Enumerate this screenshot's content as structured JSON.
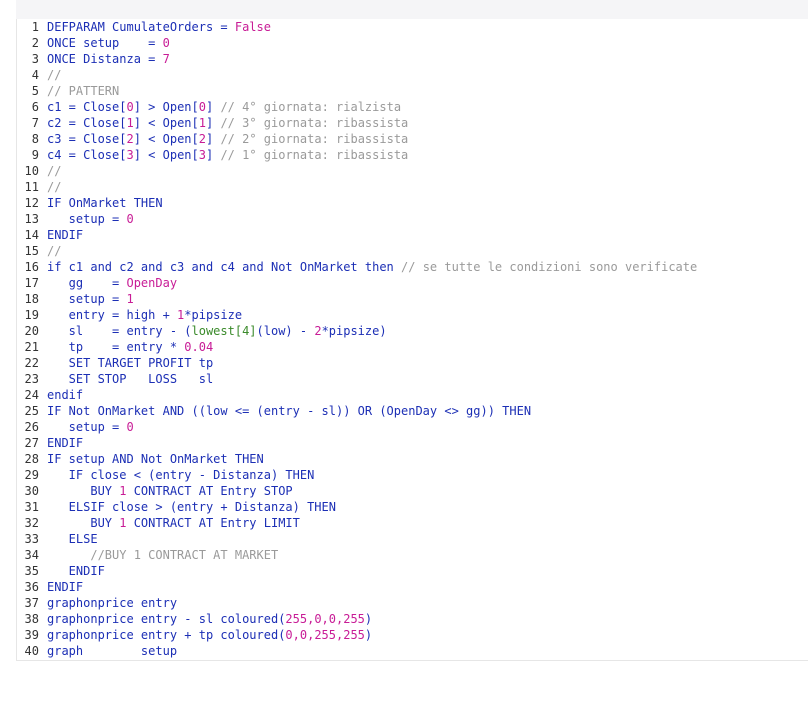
{
  "editor": {
    "lines": [
      [
        {
          "t": "DEFPARAM CumulateOrders = ",
          "c": "kw"
        },
        {
          "t": "False",
          "c": "n"
        }
      ],
      [
        {
          "t": "ONCE setup    = ",
          "c": "kw"
        },
        {
          "t": "0",
          "c": "n"
        }
      ],
      [
        {
          "t": "ONCE Distanza = ",
          "c": "kw"
        },
        {
          "t": "7",
          "c": "n"
        }
      ],
      [
        {
          "t": "//",
          "c": "c"
        }
      ],
      [
        {
          "t": "// PATTERN",
          "c": "c"
        }
      ],
      [
        {
          "t": "c1 = Close[",
          "c": "kw"
        },
        {
          "t": "0",
          "c": "n"
        },
        {
          "t": "] > Open[",
          "c": "kw"
        },
        {
          "t": "0",
          "c": "n"
        },
        {
          "t": "] ",
          "c": "kw"
        },
        {
          "t": "// 4° giornata: rialzista",
          "c": "c"
        }
      ],
      [
        {
          "t": "c2 = Close[",
          "c": "kw"
        },
        {
          "t": "1",
          "c": "n"
        },
        {
          "t": "] < Open[",
          "c": "kw"
        },
        {
          "t": "1",
          "c": "n"
        },
        {
          "t": "] ",
          "c": "kw"
        },
        {
          "t": "// 3° giornata: ribassista",
          "c": "c"
        }
      ],
      [
        {
          "t": "c3 = Close[",
          "c": "kw"
        },
        {
          "t": "2",
          "c": "n"
        },
        {
          "t": "] < Open[",
          "c": "kw"
        },
        {
          "t": "2",
          "c": "n"
        },
        {
          "t": "] ",
          "c": "kw"
        },
        {
          "t": "// 2° giornata: ribassista",
          "c": "c"
        }
      ],
      [
        {
          "t": "c4 = Close[",
          "c": "kw"
        },
        {
          "t": "3",
          "c": "n"
        },
        {
          "t": "] < Open[",
          "c": "kw"
        },
        {
          "t": "3",
          "c": "n"
        },
        {
          "t": "] ",
          "c": "kw"
        },
        {
          "t": "// 1° giornata: ribassista",
          "c": "c"
        }
      ],
      [
        {
          "t": "//",
          "c": "c"
        }
      ],
      [
        {
          "t": "//",
          "c": "c"
        }
      ],
      [
        {
          "t": "IF OnMarket THEN",
          "c": "kw"
        }
      ],
      [
        {
          "t": "   setup = ",
          "c": "kw"
        },
        {
          "t": "0",
          "c": "n"
        }
      ],
      [
        {
          "t": "ENDIF",
          "c": "kw"
        }
      ],
      [
        {
          "t": "//",
          "c": "c"
        }
      ],
      [
        {
          "t": "if c1 and c2 and c3 and c4 and Not OnMarket then ",
          "c": "kw"
        },
        {
          "t": "// se tutte le condizioni sono verificate",
          "c": "c"
        }
      ],
      [
        {
          "t": "   gg    = ",
          "c": "kw"
        },
        {
          "t": "OpenDay",
          "c": "n"
        }
      ],
      [
        {
          "t": "   setup = ",
          "c": "kw"
        },
        {
          "t": "1",
          "c": "n"
        }
      ],
      [
        {
          "t": "   entry = high + ",
          "c": "kw"
        },
        {
          "t": "1",
          "c": "n"
        },
        {
          "t": "*pipsize",
          "c": "kw"
        }
      ],
      [
        {
          "t": "   sl    = entry - (",
          "c": "kw"
        },
        {
          "t": "lowest[4]",
          "c": "f"
        },
        {
          "t": "(low) - ",
          "c": "kw"
        },
        {
          "t": "2",
          "c": "n"
        },
        {
          "t": "*pipsize)",
          "c": "kw"
        }
      ],
      [
        {
          "t": "   tp    = entry * ",
          "c": "kw"
        },
        {
          "t": "0.04",
          "c": "n"
        }
      ],
      [
        {
          "t": "   SET TARGET PROFIT tp",
          "c": "kw"
        }
      ],
      [
        {
          "t": "   SET STOP   LOSS   sl",
          "c": "kw"
        }
      ],
      [
        {
          "t": "endif",
          "c": "kw"
        }
      ],
      [
        {
          "t": "IF Not OnMarket AND ((low <= (entry - sl)) OR (OpenDay <> gg)) THEN",
          "c": "kw"
        }
      ],
      [
        {
          "t": "   setup = ",
          "c": "kw"
        },
        {
          "t": "0",
          "c": "n"
        }
      ],
      [
        {
          "t": "ENDIF",
          "c": "kw"
        }
      ],
      [
        {
          "t": "IF setup AND Not OnMarket THEN",
          "c": "kw"
        }
      ],
      [
        {
          "t": "   IF close < (entry - Distanza) THEN",
          "c": "kw"
        }
      ],
      [
        {
          "t": "      BUY ",
          "c": "kw"
        },
        {
          "t": "1",
          "c": "n"
        },
        {
          "t": " CONTRACT AT Entry STOP",
          "c": "kw"
        }
      ],
      [
        {
          "t": "   ELSIF close > (entry + Distanza) THEN",
          "c": "kw"
        }
      ],
      [
        {
          "t": "      BUY ",
          "c": "kw"
        },
        {
          "t": "1",
          "c": "n"
        },
        {
          "t": " CONTRACT AT Entry LIMIT",
          "c": "kw"
        }
      ],
      [
        {
          "t": "   ELSE",
          "c": "kw"
        }
      ],
      [
        {
          "t": "      //BUY 1 CONTRACT AT MARKET",
          "c": "c"
        }
      ],
      [
        {
          "t": "   ENDIF",
          "c": "kw"
        }
      ],
      [
        {
          "t": "ENDIF",
          "c": "kw"
        }
      ],
      [
        {
          "t": "graphonprice entry",
          "c": "kw"
        }
      ],
      [
        {
          "t": "graphonprice entry - sl coloured(",
          "c": "kw"
        },
        {
          "t": "255,0,0,255",
          "c": "n"
        },
        {
          "t": ")",
          "c": "kw"
        }
      ],
      [
        {
          "t": "graphonprice entry + tp coloured(",
          "c": "kw"
        },
        {
          "t": "0,0,255,255",
          "c": "n"
        },
        {
          "t": ")",
          "c": "kw"
        }
      ],
      [
        {
          "t": "graph        setup",
          "c": "kw"
        }
      ]
    ],
    "line_numbers": [
      "1",
      "2",
      "3",
      "4",
      "5",
      "6",
      "7",
      "8",
      "9",
      "10",
      "11",
      "12",
      "13",
      "14",
      "15",
      "16",
      "17",
      "18",
      "19",
      "20",
      "21",
      "22",
      "23",
      "24",
      "25",
      "26",
      "27",
      "28",
      "29",
      "30",
      "31",
      "32",
      "33",
      "34",
      "35",
      "36",
      "37",
      "38",
      "39",
      "40"
    ]
  },
  "colors": {
    "keyword": "#1c2fb5",
    "number": "#c81c96",
    "comment": "#9a9a9a",
    "function": "#3a8a2a",
    "background": "#ffffff",
    "header": "#f5f5f7"
  }
}
